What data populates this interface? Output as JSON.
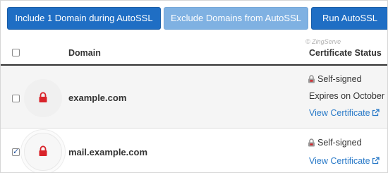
{
  "toolbar": {
    "include_label": "Include 1 Domain during AutoSSL",
    "exclude_label": "Exclude Domains from AutoSSL",
    "run_label": "Run AutoSSL"
  },
  "table": {
    "headers": {
      "domain": "Domain",
      "certificate_status": "Certificate Status"
    },
    "watermark": "© ZingServe",
    "rows": [
      {
        "domain": "example.com",
        "checked": false,
        "status": "Self-signed",
        "expires": "Expires on October",
        "view_label": "View Certificate"
      },
      {
        "domain": "mail.example.com",
        "checked": true,
        "status": "Self-signed",
        "view_label": "View Certificate"
      }
    ]
  },
  "colors": {
    "primary_button": "#1f6ec4",
    "disabled_button": "#7fb1e2",
    "link": "#2a7ac8",
    "lock_icon": "#d9232a"
  },
  "icons": [
    "padlock-icon",
    "status-lock-icon",
    "external-link-icon",
    "checkbox-icon"
  ]
}
